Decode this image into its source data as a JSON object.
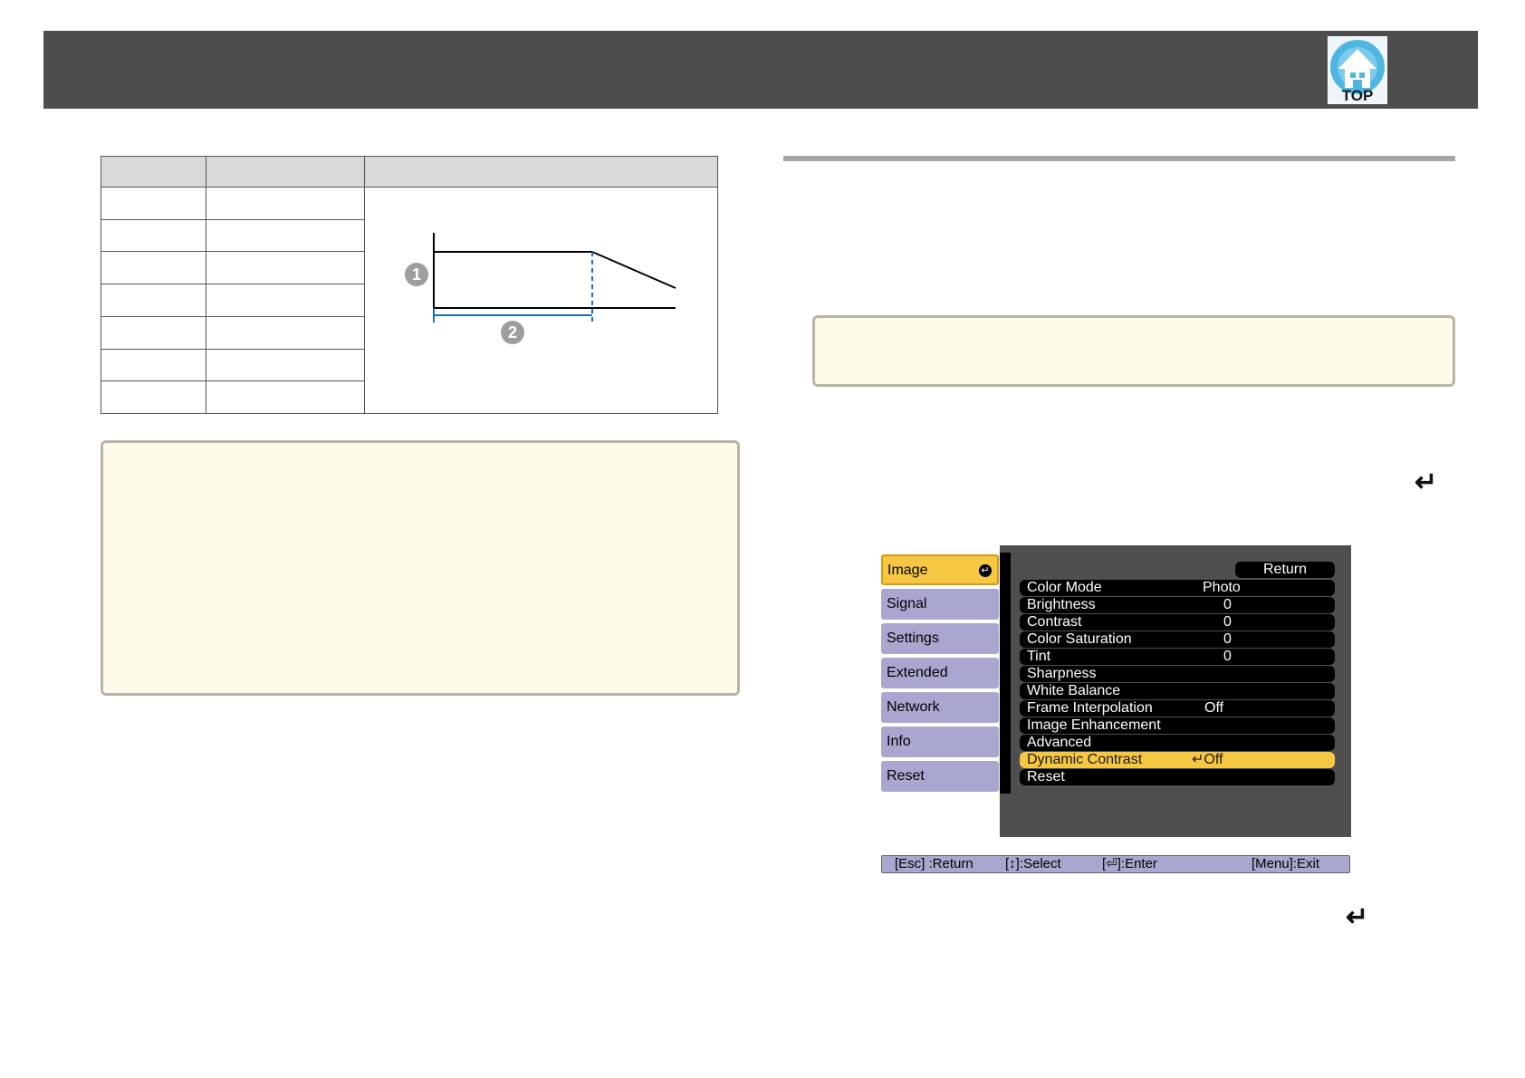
{
  "header": {
    "top_button_label": "TOP",
    "brand_color": "#4d4d4d"
  },
  "graph": {
    "marker_1": "1",
    "marker_2": "2"
  },
  "menu": {
    "tabs": [
      {
        "label": "Image",
        "active": true
      },
      {
        "label": "Signal"
      },
      {
        "label": "Settings"
      },
      {
        "label": "Extended"
      },
      {
        "label": "Network"
      },
      {
        "label": "Info"
      },
      {
        "label": "Reset"
      }
    ],
    "return_label": "Return",
    "items": [
      {
        "label": "Color Mode",
        "value": "Photo"
      },
      {
        "label": "Brightness",
        "value": "0"
      },
      {
        "label": "Contrast",
        "value": "0"
      },
      {
        "label": "Color Saturation",
        "value": "0"
      },
      {
        "label": "Tint",
        "value": "0"
      },
      {
        "label": "Sharpness",
        "value": ""
      },
      {
        "label": "White Balance",
        "value": ""
      },
      {
        "label": "Frame Interpolation",
        "value": "Off"
      },
      {
        "label": "Image Enhancement",
        "value": ""
      },
      {
        "label": "Advanced",
        "value": ""
      },
      {
        "label": "Dynamic Contrast",
        "value": "Off",
        "selected": true
      },
      {
        "label": "Reset",
        "value": ""
      }
    ],
    "help_bar": {
      "esc": "[Esc] :Return",
      "select": "[↕]:Select",
      "enter": "[⏎]:Enter",
      "exit": "[Menu]:Exit"
    },
    "colors": {
      "tab": "#a9a7cf",
      "highlight": "#f6c743",
      "panel": "#4f4f4f"
    }
  },
  "icons": {
    "top_button": "house-icon",
    "enter_symbol": "enter-arrow-icon"
  }
}
